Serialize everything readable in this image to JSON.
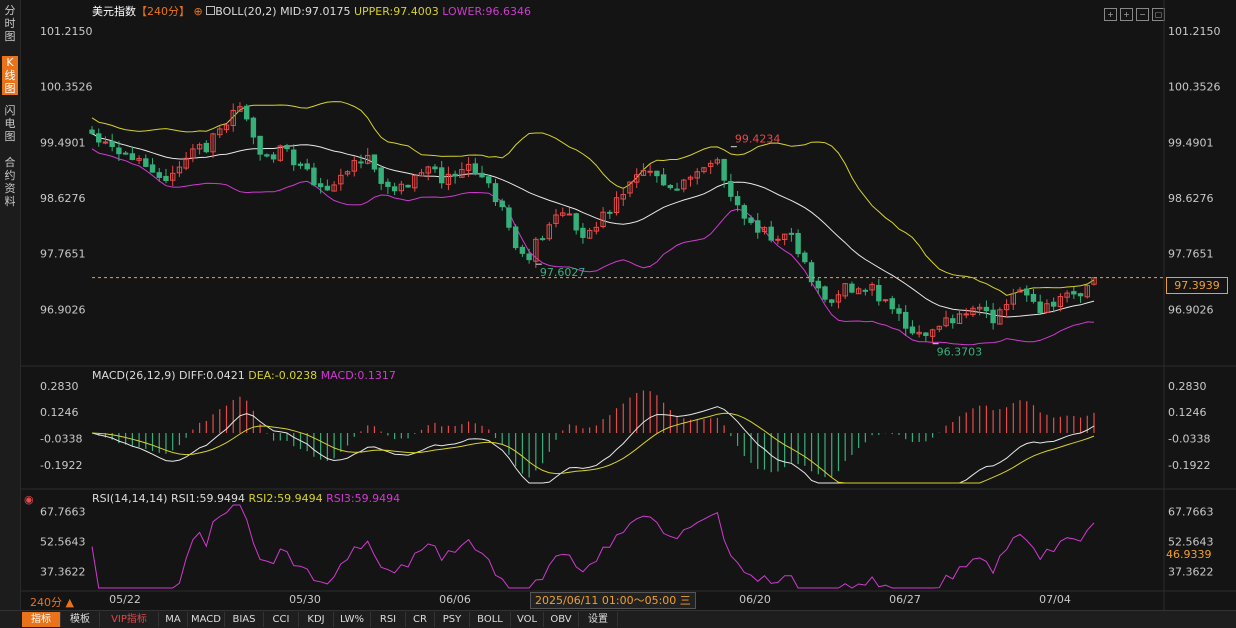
{
  "sidebar": [
    "分时图",
    "K线图",
    "闪电图",
    "合约资料"
  ],
  "header": {
    "instrument": "美元指数",
    "period": "【240分】",
    "boll_label": "BOLL(20,2)",
    "mid": "MID:97.0175",
    "upper": "UPPER:97.4003",
    "lower": "LOWER:96.6346"
  },
  "macd_header": {
    "label": "MACD(26,12,9)",
    "diff": "DIFF:0.0421",
    "dea": "DEA:-0.0238",
    "macd": "MACD:0.1317"
  },
  "rsi_header": {
    "label": "RSI(14,14,14)",
    "rsi1": "RSI1:59.9494",
    "rsi2": "RSI2:59.9494",
    "rsi3": "RSI3:59.9494"
  },
  "price_axis": [
    "101.2150",
    "100.3526",
    "99.4901",
    "98.6276",
    "97.7651",
    "96.9026"
  ],
  "macd_axis": [
    "0.2830",
    "0.1246",
    "-0.0338",
    "-0.1922"
  ],
  "rsi_axis": [
    "67.7663",
    "52.5643",
    "37.3622"
  ],
  "x_labels": [
    "05/22",
    "05/30",
    "06/06",
    "06/20",
    "06/27",
    "07/04"
  ],
  "current_price": "97.3939",
  "current_rsi": "46.9339",
  "annotations": {
    "high": "99.4234",
    "low1": "97.6027",
    "low2": "96.3703"
  },
  "crosshair_time": "2025/06/11 01:00～05:00 三",
  "period_selector": "240分 ▲",
  "tabs": [
    "指标",
    "模板",
    "VIP指标",
    "MA",
    "MACD",
    "BIAS",
    "CCI",
    "KDJ",
    "LW%",
    "RSI",
    "CR",
    "PSY",
    "BOLL",
    "VOL",
    "OBV",
    "设置"
  ],
  "colors": {
    "up": "#e84a4a",
    "down": "#36b07a",
    "mid": "#e8e8e8",
    "upper": "#d6d22a",
    "lower": "#d03ad0",
    "diff": "#e8e8e8",
    "dea": "#d6d22a",
    "rsi": "#d03ad0",
    "accent": "#e8731a"
  },
  "chart_data": {
    "type": "candlestick",
    "x": [
      "05/22",
      "05/30",
      "06/06",
      "06/20",
      "06/27",
      "07/04"
    ],
    "close_path": [
      99.65,
      99.55,
      99.4,
      99.25,
      99.05,
      98.95,
      99.15,
      99.3,
      99.45,
      99.75,
      100.15,
      99.6,
      99.25,
      99.4,
      99.2,
      98.95,
      98.85,
      98.9,
      99.1,
      99.2,
      98.9,
      98.75,
      98.9,
      99.05,
      98.95,
      99.0,
      99.1,
      98.95,
      98.55,
      97.95,
      97.7,
      98.05,
      98.4,
      98.3,
      98.05,
      98.25,
      98.6,
      98.8,
      99.0,
      98.9,
      98.7,
      98.85,
      99.1,
      99.35,
      98.7,
      98.3,
      98.15,
      98.0,
      98.1,
      97.6,
      97.2,
      97.05,
      97.25,
      97.3,
      97.15,
      97.0,
      96.7,
      96.45,
      96.6,
      96.75,
      96.85,
      96.95,
      96.8,
      96.9,
      97.25,
      96.95,
      96.95,
      97.05,
      97.15,
      97.39
    ],
    "close_start": 99.65,
    "close_end": 97.3939,
    "period_high": 99.4234,
    "period_low": 96.3703,
    "boll": {
      "mid": 97.0175,
      "upper": 97.4003,
      "lower": 96.6346
    },
    "macd": {
      "diff": 0.0421,
      "dea": -0.0238,
      "macd": 0.1317
    },
    "rsi": {
      "rsi1": 59.9494,
      "rsi2": 59.9494,
      "rsi3": 59.9494
    },
    "price_ylim": [
      96.04,
      101.48
    ],
    "macd_ylim": [
      -0.33,
      0.33
    ],
    "rsi_ylim": [
      28,
      72
    ]
  }
}
